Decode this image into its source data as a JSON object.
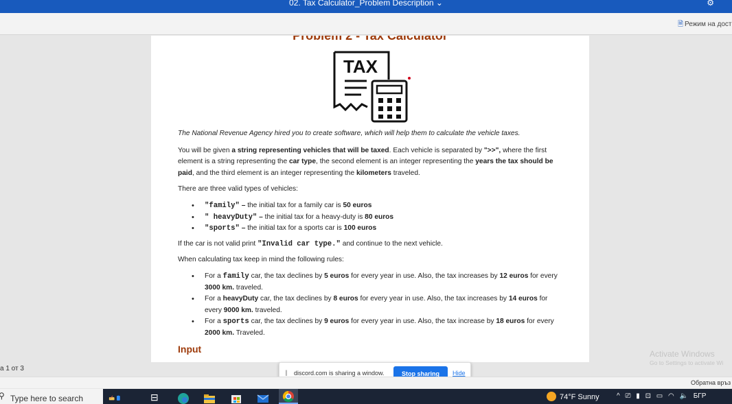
{
  "titlebar": {
    "title": "02. Tax Calculator_Problem Description",
    "chevron": "⌄"
  },
  "ribbon": {
    "accessibility_mode": "Режим на дост"
  },
  "document": {
    "title": "Problem 2 - Tax Calculator",
    "icon_text": "TAX",
    "intro": "The National Revenue Agency hired you to create software, which will help them to calculate the vehicle taxes.",
    "p1": {
      "t1": "You will be given ",
      "b1": "a string representing vehicles that will be taxed",
      "t2": ". Each vehicle is separated by ",
      "b2": "\">>\",",
      "t3": " where the first element is a string representing the ",
      "b3": "car type",
      "t4": ", the second element is an integer representing the ",
      "b4": "years the tax should be paid",
      "t5": ", and the third element is an integer representing the ",
      "b5": "kilometers",
      "t6": " traveled."
    },
    "types_intro": "There are three valid types of vehicles:",
    "types": [
      {
        "code": "\"family\"",
        "dash": " – ",
        "text": " the initial tax for a family car is ",
        "amount": "50 euros"
      },
      {
        "code": "\" heavyDuty\"",
        "dash": " – ",
        "text": " the initial tax for a heavy-duty is ",
        "amount": "80 euros"
      },
      {
        "code": "\"sports\"",
        "dash": " – ",
        "text": " the initial tax for a sports car is ",
        "amount": "100 euros"
      }
    ],
    "invalid": {
      "t1": "If the car is not valid print ",
      "code": "\"Invalid car type.\"",
      "t2": " and continue to the next vehicle."
    },
    "rules_intro": "When calculating tax keep in mind the following rules:",
    "rules": [
      {
        "t1": "For a ",
        "type": "family",
        "t2": " car, the tax declines by ",
        "dec": "5 euros",
        "t3": " for every year in use. Also, the tax increases by ",
        "inc": "12 euros",
        "t4": " for every ",
        "km": "3000 km.",
        "t5": " traveled."
      },
      {
        "t1": "For a ",
        "type": "heavyDuty",
        "t2": " car, the tax declines by ",
        "dec": "8 euros",
        "t3": " for every year in use. Also, the tax increases by ",
        "inc": "14 euros",
        "t4": " for every ",
        "km": "9000 km.",
        "t5": " traveled."
      },
      {
        "t1": "For a ",
        "type": "sports",
        "t2": " car, the tax declines by ",
        "dec": "9 euros",
        "t3": " for every year in use. Also, the tax increase by ",
        "inc": "18 euros",
        "t4": " for every ",
        "km": "2000 km.",
        "t5": " Traveled."
      }
    ],
    "section_heading": "Input"
  },
  "status": {
    "page_count": "а 1 от 3",
    "feedback": "Обратна връз"
  },
  "watermark": {
    "line1": "Activate Windows",
    "line2": "Go to Settings to activate Wi"
  },
  "share_bar": {
    "handle": "||",
    "message": "discord.com is sharing a window.",
    "stop_label": "Stop sharing",
    "hide_label": "Hide"
  },
  "taskbar": {
    "search_placeholder": "Type here to search",
    "weather": "74°F  Sunny",
    "language": "БГР",
    "tray_symbols": [
      "^",
      "⎚",
      "▮",
      "⊡",
      "▭",
      "◠",
      "🔈"
    ]
  },
  "colors": {
    "title_bar": "#185abd",
    "heading": "#9e3b0b",
    "stop_button": "#1a73e8",
    "taskbar": "#1b2435"
  }
}
